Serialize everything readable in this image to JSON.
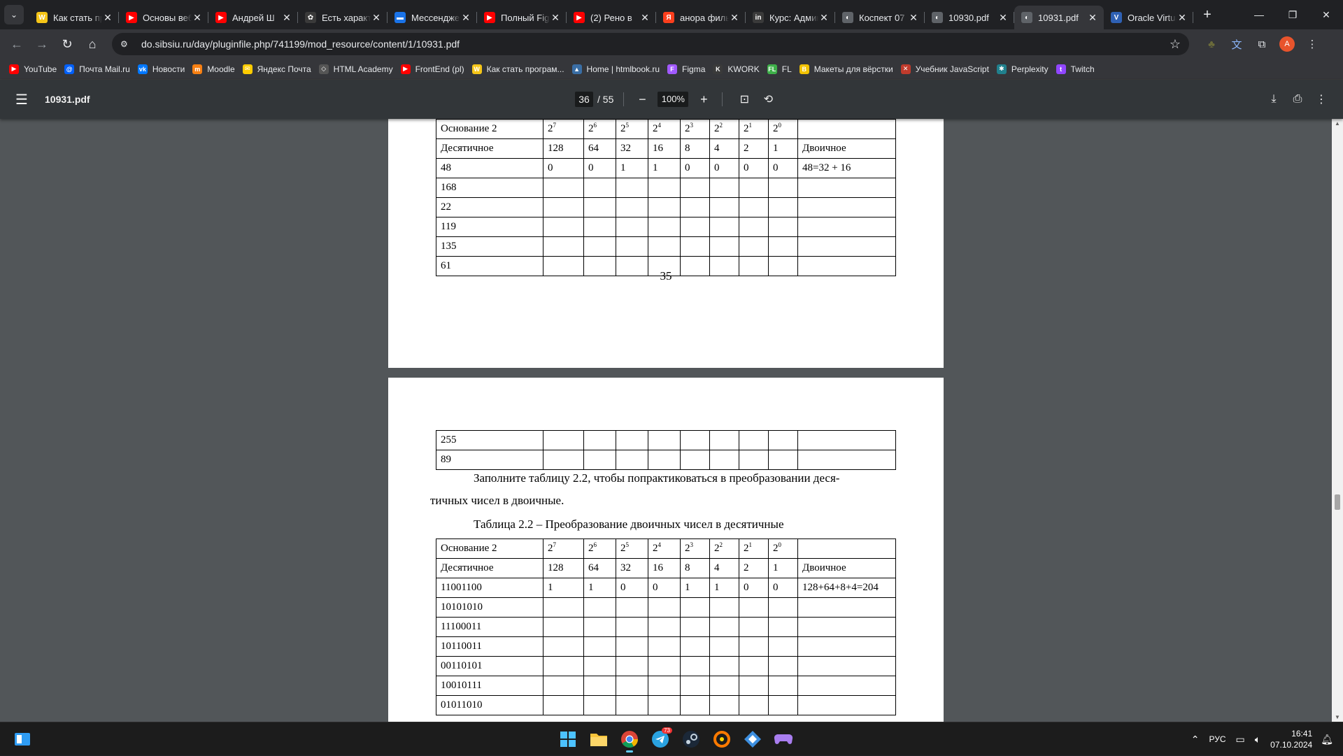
{
  "tabs": [
    {
      "title": "Как стать программистом",
      "fav": "W",
      "color": "#f5c518",
      "active": false
    },
    {
      "title": "Основы веб-разработки",
      "fav": "▶",
      "color": "#ff0000",
      "active": false
    },
    {
      "title": "Андрей Ш",
      "fav": "▶",
      "color": "#ff0000",
      "active": false
    },
    {
      "title": "Есть характер",
      "fav": "✿",
      "color": "#3a3a3a",
      "active": false
    },
    {
      "title": "Мессенджер",
      "fav": "▬",
      "color": "#1a73e8",
      "active": false
    },
    {
      "title": "Полный Figma",
      "fav": "▶",
      "color": "#ff0000",
      "active": false
    },
    {
      "title": "(2) Рено в",
      "fav": "▶",
      "color": "#ff0000",
      "active": false
    },
    {
      "title": "анора фильм",
      "fav": "Я",
      "color": "#fc3f1d",
      "active": false
    },
    {
      "title": "Курс: Администрирование",
      "fav": "in",
      "color": "#3a3a3a",
      "active": false
    },
    {
      "title": "Коспект 07",
      "fav": "◐",
      "color": "#5f6368",
      "active": false
    },
    {
      "title": "10930.pdf",
      "fav": "◐",
      "color": "#5f6368",
      "active": false
    },
    {
      "title": "10931.pdf",
      "fav": "◐",
      "color": "#5f6368",
      "active": true
    },
    {
      "title": "Oracle VirtualBox",
      "fav": "V",
      "color": "#2f61b4",
      "active": false
    }
  ],
  "url": "do.sibsiu.ru/day/pluginfile.php/741199/mod_resource/content/1/10931.pdf",
  "bookmarks": [
    {
      "label": "YouTube",
      "fav": "▶",
      "color": "#ff0000"
    },
    {
      "label": "Почта Mail.ru",
      "fav": "@",
      "color": "#005ff9"
    },
    {
      "label": "Новости",
      "fav": "vk",
      "color": "#0077ff"
    },
    {
      "label": "Moodle",
      "fav": "m",
      "color": "#f98012"
    },
    {
      "label": "Яндекс Почта",
      "fav": "✉",
      "color": "#ffcc00"
    },
    {
      "label": "HTML Academy",
      "fav": "◇",
      "color": "#555555"
    },
    {
      "label": "FrontEnd (pl)",
      "fav": "▶",
      "color": "#ff0000"
    },
    {
      "label": "Как стать програм...",
      "fav": "W",
      "color": "#f5c518"
    },
    {
      "label": "Home | htmlbook.ru",
      "fav": "▲",
      "color": "#3a6ea5"
    },
    {
      "label": "Figma",
      "fav": "F",
      "color": "#a259ff"
    },
    {
      "label": "KWORK",
      "fav": "K",
      "color": "#3a3a3a"
    },
    {
      "label": "FL",
      "fav": "FL",
      "color": "#3eb049"
    },
    {
      "label": "Макеты для вёрстки",
      "fav": "B",
      "color": "#f2c200"
    },
    {
      "label": "Учебник JavaScript",
      "fav": "✕",
      "color": "#c13b2c"
    },
    {
      "label": "Perplexity",
      "fav": "✱",
      "color": "#20808d"
    },
    {
      "label": "Twitch",
      "fav": "t",
      "color": "#9146ff"
    }
  ],
  "pdf": {
    "filename": "10931.pdf",
    "page_current": "36",
    "page_total": "/ 55",
    "zoom": "100%"
  },
  "header_row": [
    "Основание 2",
    "2",
    "2",
    "2",
    "2",
    "2",
    "2",
    "2",
    "2",
    ""
  ],
  "header_exp": [
    "",
    "7",
    "6",
    "5",
    "4",
    "3",
    "2",
    "1",
    "0",
    ""
  ],
  "weights_row": [
    "Десятичное",
    "128",
    "64",
    "32",
    "16",
    "8",
    "4",
    "2",
    "1",
    "Двоичное"
  ],
  "table1_rows": [
    [
      "48",
      "0",
      "0",
      "1",
      "1",
      "0",
      "0",
      "0",
      "0",
      "48=32 + 16"
    ],
    [
      "168",
      "",
      "",
      "",
      "",
      "",
      "",
      "",
      "",
      ""
    ],
    [
      "22",
      "",
      "",
      "",
      "",
      "",
      "",
      "",
      "",
      ""
    ],
    [
      "119",
      "",
      "",
      "",
      "",
      "",
      "",
      "",
      "",
      ""
    ],
    [
      "135",
      "",
      "",
      "",
      "",
      "",
      "",
      "",
      "",
      ""
    ],
    [
      "61",
      "",
      "",
      "",
      "",
      "",
      "",
      "",
      "",
      ""
    ]
  ],
  "page1_number": "35",
  "table1_cont_rows": [
    [
      "255",
      "",
      "",
      "",
      "",
      "",
      "",
      "",
      "",
      ""
    ],
    [
      "89",
      "",
      "",
      "",
      "",
      "",
      "",
      "",
      "",
      ""
    ]
  ],
  "paragraph_line1": "Заполните таблицу 2.2, чтобы попрактиковаться в преобразовании деся-",
  "paragraph_line2": "тичных чисел в двоичные.",
  "table2_caption": "Таблица 2.2 – Преобразование двоичных чисел в десятичные",
  "table2_rows": [
    [
      "11001100",
      "1",
      "1",
      "0",
      "0",
      "1",
      "1",
      "0",
      "0",
      "128+64+8+4=204"
    ],
    [
      "10101010",
      "",
      "",
      "",
      "",
      "",
      "",
      "",
      "",
      ""
    ],
    [
      "11100011",
      "",
      "",
      "",
      "",
      "",
      "",
      "",
      "",
      ""
    ],
    [
      "10110011",
      "",
      "",
      "",
      "",
      "",
      "",
      "",
      "",
      ""
    ],
    [
      "00110101",
      "",
      "",
      "",
      "",
      "",
      "",
      "",
      "",
      ""
    ],
    [
      "10010111",
      "",
      "",
      "",
      "",
      "",
      "",
      "",
      "",
      ""
    ],
    [
      "01011010",
      "",
      "",
      "",
      "",
      "",
      "",
      "",
      "",
      ""
    ]
  ],
  "taskbar": {
    "telegram_badge": "73",
    "lang": "РУС",
    "time": "16:41",
    "date": "07.10.2024"
  }
}
